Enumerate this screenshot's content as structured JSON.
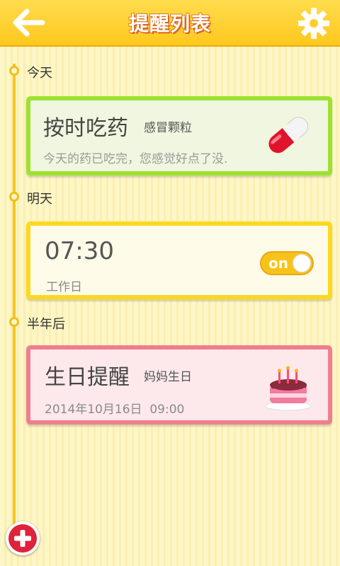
{
  "header": {
    "title": "提醒列表",
    "back_icon": "back-arrow-icon",
    "settings_icon": "gear-icon"
  },
  "sections": [
    {
      "label": "今天",
      "card": {
        "title": "按时吃药",
        "subtitle": "感冒颗粒",
        "description": "今天的药已吃完，您感觉好点了没.",
        "icon": "pill-capsule-icon",
        "color": "#9ce22f"
      }
    },
    {
      "label": "明天",
      "card": {
        "time": "07:30",
        "repeat": "工作日",
        "toggle_label": "on",
        "color": "#fdd81f"
      }
    },
    {
      "label": "半年后",
      "card": {
        "title": "生日提醒",
        "subtitle": "妈妈生日",
        "datetime": "2014年10月16日  09:00",
        "icon": "birthday-cake-icon",
        "color": "#ef7f8f"
      }
    }
  ],
  "fab": {
    "icon": "plus-icon"
  }
}
